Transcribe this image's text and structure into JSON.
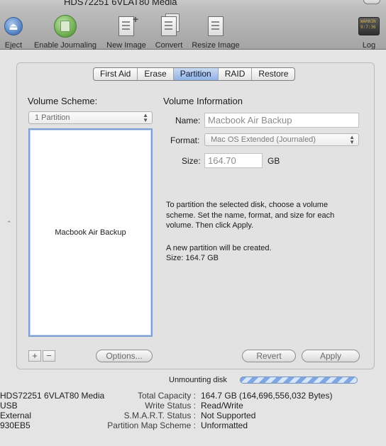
{
  "window": {
    "title": "HDS72251 6VLAT80 Media"
  },
  "toolbar": {
    "eject": "Eject",
    "enable_journaling": "Enable Journaling",
    "new_image": "New Image",
    "convert": "Convert",
    "resize_image": "Resize Image",
    "log": "Log",
    "log_screen_text": "WARNIN\n9:7:36 I"
  },
  "tabs": [
    {
      "label": "First Aid",
      "active": false
    },
    {
      "label": "Erase",
      "active": false
    },
    {
      "label": "Partition",
      "active": true
    },
    {
      "label": "RAID",
      "active": false
    },
    {
      "label": "Restore",
      "active": false
    }
  ],
  "volume_scheme": {
    "heading": "Volume Scheme:",
    "selected": "1 Partition",
    "partition_label": "Macbook Air Backup"
  },
  "volume_info": {
    "heading": "Volume Information",
    "name_label": "Name:",
    "name_value": "Macbook Air Backup",
    "format_label": "Format:",
    "format_value": "Mac OS Extended (Journaled)",
    "size_label": "Size:",
    "size_value": "164.70",
    "size_unit": "GB",
    "instructions": "To partition the selected disk, choose a volume scheme. Set the name, format, and size for each volume. Then click Apply.",
    "notice_line1": "A new partition will be created.",
    "notice_line2": "Size: 164.7 GB"
  },
  "buttons": {
    "add": "+",
    "remove": "−",
    "options": "Options...",
    "revert": "Revert",
    "apply": "Apply"
  },
  "status": {
    "text": "Unmounting disk",
    "progress_state": "indeterminate"
  },
  "disk_info": {
    "left": [
      "HDS72251 6VLAT80 Media",
      "USB",
      "External",
      "930EB5"
    ],
    "rows": [
      {
        "key": "Total Capacity :",
        "value": "164.7 GB (164,696,556,032 Bytes)"
      },
      {
        "key": "Write Status :",
        "value": "Read/Write"
      },
      {
        "key": "S.M.A.R.T. Status :",
        "value": "Not Supported"
      },
      {
        "key": "Partition Map Scheme :",
        "value": "Unformatted"
      }
    ]
  },
  "colors": {
    "selection_blue": "#8fb2e8",
    "progress_stripe": "#7ea7e6"
  }
}
